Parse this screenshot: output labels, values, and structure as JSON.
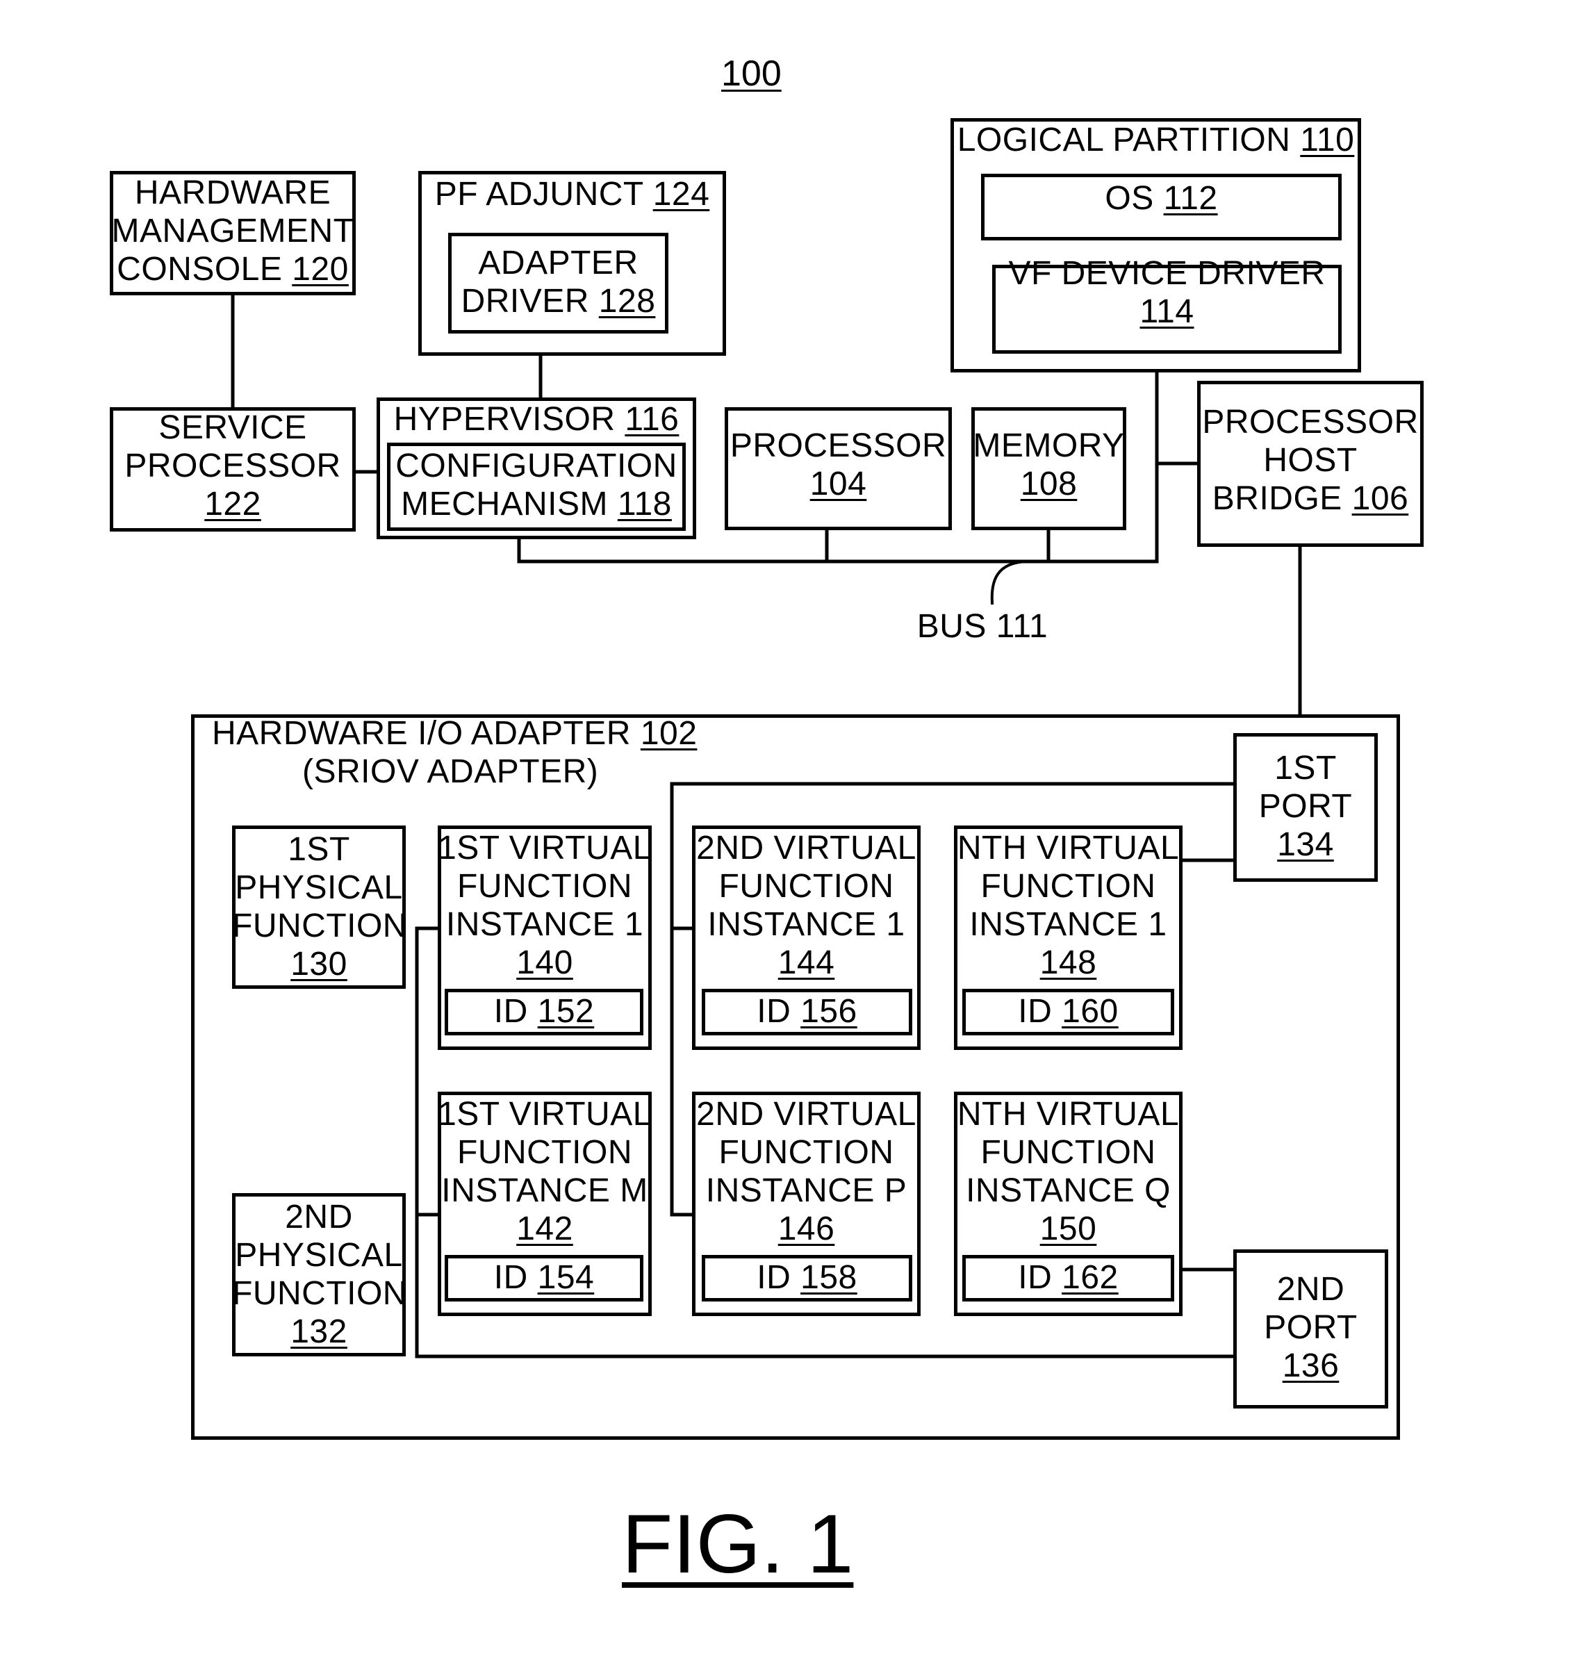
{
  "figure": {
    "system_ref": "100",
    "caption": "FIG. 1",
    "bus_label": "BUS 111"
  },
  "components": {
    "hmc": {
      "lines": [
        "HARDWARE",
        "MANAGEMENT",
        "CONSOLE"
      ],
      "ref": "120"
    },
    "service_processor": {
      "lines": [
        "SERVICE",
        "PROCESSOR"
      ],
      "ref": "122"
    },
    "pf_adjunct": {
      "lines": [
        "PF ADJUNCT"
      ],
      "ref": "124"
    },
    "adapter_driver": {
      "lines": [
        "ADAPTER",
        "DRIVER"
      ],
      "ref": "128"
    },
    "hypervisor": {
      "lines": [
        "HYPERVISOR"
      ],
      "ref": "116"
    },
    "config_mechanism": {
      "lines": [
        "CONFIGURATION",
        "MECHANISM"
      ],
      "ref": "118"
    },
    "processor": {
      "lines": [
        "PROCESSOR"
      ],
      "ref": "104"
    },
    "memory": {
      "lines": [
        "MEMORY"
      ],
      "ref": "108"
    },
    "logical_partition": {
      "lines": [
        "LOGICAL PARTITION"
      ],
      "ref": "110"
    },
    "os": {
      "lines": [
        "OS"
      ],
      "ref": "112"
    },
    "vf_device_driver": {
      "lines": [
        "VF DEVICE DRIVER"
      ],
      "ref": "114"
    },
    "processor_host_bridge": {
      "lines": [
        "PROCESSOR",
        "HOST",
        "BRIDGE"
      ],
      "ref": "106"
    },
    "io_adapter": {
      "lines": [
        "HARDWARE I/O ADAPTER",
        "(SRIOV ADAPTER)"
      ],
      "ref": "102"
    },
    "pf1": {
      "lines": [
        "1ST",
        "PHYSICAL",
        "FUNCTION"
      ],
      "ref": "130"
    },
    "pf2": {
      "lines": [
        "2ND",
        "PHYSICAL",
        "FUNCTION"
      ],
      "ref": "132"
    },
    "port1": {
      "lines": [
        "1ST",
        "PORT"
      ],
      "ref": "134"
    },
    "port2": {
      "lines": [
        "2ND",
        "PORT"
      ],
      "ref": "136"
    },
    "vf140": {
      "lines": [
        "1ST VIRTUAL",
        "FUNCTION",
        "INSTANCE 1"
      ],
      "ref": "140",
      "id_label": "ID",
      "id_ref": "152"
    },
    "vf142": {
      "lines": [
        "1ST VIRTUAL",
        "FUNCTION",
        "INSTANCE M"
      ],
      "ref": "142",
      "id_label": "ID",
      "id_ref": "154"
    },
    "vf144": {
      "lines": [
        "2ND VIRTUAL",
        "FUNCTION",
        "INSTANCE 1"
      ],
      "ref": "144",
      "id_label": "ID",
      "id_ref": "156"
    },
    "vf146": {
      "lines": [
        "2ND VIRTUAL",
        "FUNCTION",
        "INSTANCE P"
      ],
      "ref": "146",
      "id_label": "ID",
      "id_ref": "158"
    },
    "vf148": {
      "lines": [
        "NTH VIRTUAL",
        "FUNCTION",
        "INSTANCE 1"
      ],
      "ref": "148",
      "id_label": "ID",
      "id_ref": "160"
    },
    "vf150": {
      "lines": [
        "NTH VIRTUAL",
        "FUNCTION",
        "INSTANCE Q"
      ],
      "ref": "150",
      "id_label": "ID",
      "id_ref": "162"
    }
  }
}
